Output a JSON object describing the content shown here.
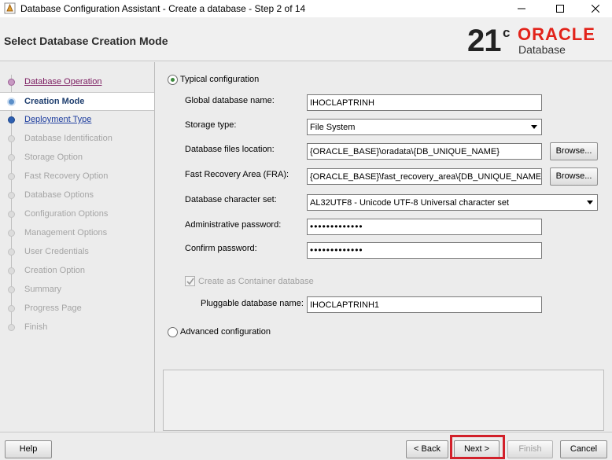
{
  "window": {
    "title": "Database Configuration Assistant - Create a database - Step 2 of 14",
    "controls": {
      "minimize": "minimize-icon",
      "maximize": "maximize-icon",
      "close": "close-icon"
    }
  },
  "header": {
    "page_title": "Select Database Creation Mode",
    "logo": {
      "version": "21",
      "version_sup": "c",
      "brand": "ORACLE",
      "product": "Database"
    }
  },
  "nav": {
    "items": [
      {
        "label": "Database Operation",
        "state": "done"
      },
      {
        "label": "Creation Mode",
        "state": "current"
      },
      {
        "label": "Deployment Type",
        "state": "next"
      },
      {
        "label": "Database Identification",
        "state": "todo"
      },
      {
        "label": "Storage Option",
        "state": "todo"
      },
      {
        "label": "Fast Recovery Option",
        "state": "todo"
      },
      {
        "label": "Database Options",
        "state": "todo"
      },
      {
        "label": "Configuration Options",
        "state": "todo"
      },
      {
        "label": "Management Options",
        "state": "todo"
      },
      {
        "label": "User Credentials",
        "state": "todo"
      },
      {
        "label": "Creation Option",
        "state": "todo"
      },
      {
        "label": "Summary",
        "state": "todo"
      },
      {
        "label": "Progress Page",
        "state": "todo"
      },
      {
        "label": "Finish",
        "state": "todo"
      }
    ]
  },
  "form": {
    "typical_label": "Typical configuration",
    "typical_selected": true,
    "global_db_name_label": "Global database name:",
    "global_db_name_value": "IHOCLAPTRINH",
    "storage_type_label": "Storage type:",
    "storage_type_value": "File System",
    "db_files_location_label": "Database files location:",
    "db_files_location_value": "{ORACLE_BASE}\\oradata\\{DB_UNIQUE_NAME}",
    "fra_label": "Fast Recovery Area (FRA):",
    "fra_value": "{ORACLE_BASE}\\fast_recovery_area\\{DB_UNIQUE_NAME}",
    "browse_label": "Browse...",
    "charset_label": "Database character set:",
    "charset_value": "AL32UTF8 - Unicode UTF-8 Universal character set",
    "admin_password_label": "Administrative password:",
    "admin_password_value": "•••••••••••••",
    "confirm_password_label": "Confirm password:",
    "confirm_password_value": "•••••••••••••",
    "container_db_label": "Create as Container database",
    "container_db_checked": true,
    "pdb_name_label": "Pluggable database name:",
    "pdb_name_value": "IHOCLAPTRINH1",
    "advanced_label": "Advanced configuration",
    "advanced_selected": false
  },
  "footer": {
    "help": "Help",
    "back": "< Back",
    "next": "Next >",
    "finish": "Finish",
    "cancel": "Cancel",
    "highlight_color": "#d2202a"
  }
}
